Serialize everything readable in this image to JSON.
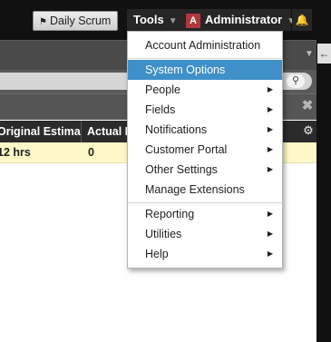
{
  "header": {
    "scrum_button": {
      "label": "Daily Scrum",
      "icon": "flag-icon"
    },
    "tools_button": {
      "label": "Tools"
    },
    "admin_button": {
      "label": "Administrator",
      "avatar_letter": "A",
      "avatar_color": "#b0373d"
    },
    "notifications_icon": "bell-icon"
  },
  "table": {
    "columns": [
      "Original Estimate",
      "Actual Hours"
    ],
    "visible_columns": [
      "Original Estimate",
      "Actual I"
    ],
    "rows": [
      {
        "original_estimate": "12 hrs",
        "actual": "0"
      }
    ]
  },
  "tools_menu": {
    "active_color": "#3f8fc8",
    "items": [
      {
        "label": "Account Administration",
        "submenu": false
      },
      {
        "label": "System Options",
        "submenu": false,
        "active": true
      },
      {
        "label": "People",
        "submenu": true
      },
      {
        "label": "Fields",
        "submenu": true
      },
      {
        "label": "Notifications",
        "submenu": true
      },
      {
        "label": "Customer Portal",
        "submenu": true
      },
      {
        "label": "Other Settings",
        "submenu": true
      },
      {
        "label": "Manage Extensions",
        "submenu": false
      },
      {
        "label": "Reporting",
        "submenu": true
      },
      {
        "label": "Utilities",
        "submenu": true
      },
      {
        "label": "Help",
        "submenu": true
      }
    ]
  }
}
